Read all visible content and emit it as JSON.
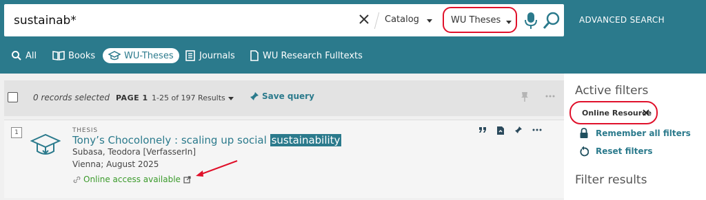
{
  "search": {
    "query": "sustainab*",
    "scope_catalog": "Catalog",
    "scope_selected": "WU Theses",
    "advanced_label": "ADVANCED SEARCH"
  },
  "tabs": [
    {
      "label": "All",
      "icon": "search-icon"
    },
    {
      "label": "Books",
      "icon": "book-icon"
    },
    {
      "label": "WU-Theses",
      "icon": "graduation-cap-icon",
      "active": true
    },
    {
      "label": "Journals",
      "icon": "journal-icon"
    },
    {
      "label": "WU Research Fulltexts",
      "icon": "document-icon"
    }
  ],
  "results_bar": {
    "selected": "0 records selected",
    "page": "PAGE 1",
    "range": "1-25 of 197 Results",
    "save_query": "Save query"
  },
  "record": {
    "number": "1",
    "type": "THESIS",
    "title_prefix": "Tony’s Chocolonely : scaling up social",
    "title_highlight": "sustainability",
    "author": "Subasa, Teodora [VerfasserIn]",
    "publication": "Vienna; August 2025",
    "access": "Online access available"
  },
  "sidebar": {
    "active_filters_title": "Active filters",
    "filter_chip": "Online Resource",
    "remember_label": "Remember all filters",
    "reset_label": "Reset filters",
    "filter_results_title": "Filter results"
  },
  "colors": {
    "brand": "#2b7a8c",
    "highlight_ring": "#e0102a",
    "access_green": "#3a9a2a"
  }
}
